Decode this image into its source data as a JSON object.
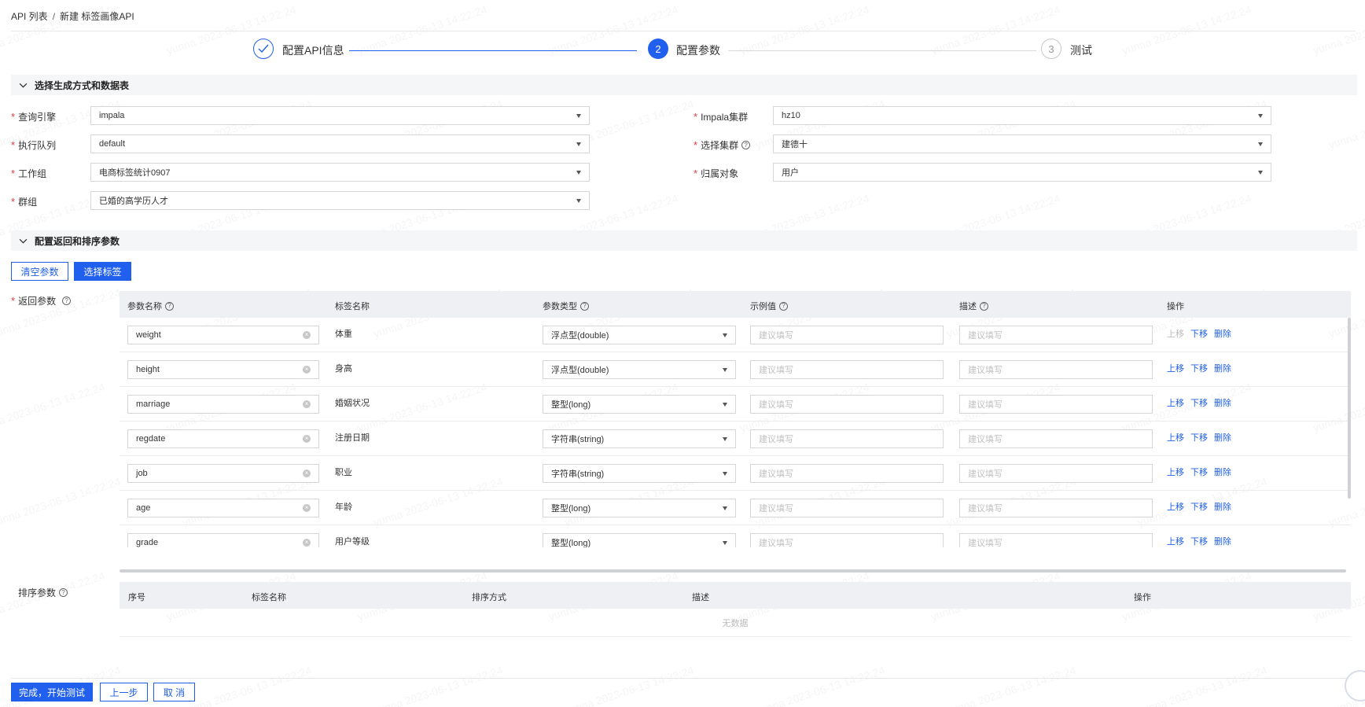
{
  "breadcrumb": {
    "parent": "API 列表",
    "separator": "/",
    "current": "新建 标签画像API"
  },
  "steps": [
    {
      "num": "✓",
      "label": "配置API信息",
      "state": "done"
    },
    {
      "num": "2",
      "label": "配置参数",
      "state": "active"
    },
    {
      "num": "3",
      "label": "测试",
      "state": "pending"
    }
  ],
  "section1": {
    "title": "选择生成方式和数据表"
  },
  "form": {
    "engine": {
      "label": "查询引擎",
      "value": "impala"
    },
    "queue": {
      "label": "执行队列",
      "value": "default"
    },
    "workgroup": {
      "label": "工作组",
      "value": "电商标签统计0907"
    },
    "group": {
      "label": "群组",
      "value": "已婚的高学历人才"
    },
    "impala_cluster": {
      "label": "Impala集群",
      "value": "hz10"
    },
    "select_cluster": {
      "label": "选择集群",
      "value": "建德十"
    },
    "owner": {
      "label": "归属对象",
      "value": "用户"
    }
  },
  "section2": {
    "title": "配置返回和排序参数"
  },
  "buttons": {
    "clear_params": "清空参数",
    "select_tags": "选择标签",
    "finish": "完成，开始测试",
    "prev": "上一步",
    "cancel": "取 消"
  },
  "return_params": {
    "label": "返回参数",
    "headers": {
      "name": "参数名称",
      "tag": "标签名称",
      "type": "参数类型",
      "example": "示例值",
      "desc": "描述",
      "ops": "操作"
    },
    "placeholder": "建议填写",
    "ops": {
      "up": "上移",
      "down": "下移",
      "del": "删除"
    },
    "rows": [
      {
        "name": "weight",
        "tag": "体重",
        "type": "浮点型(double)"
      },
      {
        "name": "height",
        "tag": "身高",
        "type": "浮点型(double)"
      },
      {
        "name": "marriage",
        "tag": "婚姻状况",
        "type": "整型(long)"
      },
      {
        "name": "regdate",
        "tag": "注册日期",
        "type": "字符串(string)"
      },
      {
        "name": "job",
        "tag": "职业",
        "type": "字符串(string)"
      },
      {
        "name": "age",
        "tag": "年龄",
        "type": "整型(long)"
      },
      {
        "name": "grade",
        "tag": "用户等级",
        "type": "整型(long)"
      }
    ]
  },
  "sort_params": {
    "label": "排序参数",
    "headers": {
      "index": "序号",
      "tag": "标签名称",
      "method": "排序方式",
      "desc": "描述",
      "ops": "操作"
    },
    "empty": "无数据"
  },
  "watermark": "yunna 2023-06-13 14:22:24",
  "colors": {
    "primary": "#2160ee",
    "required": "#e4393c"
  }
}
